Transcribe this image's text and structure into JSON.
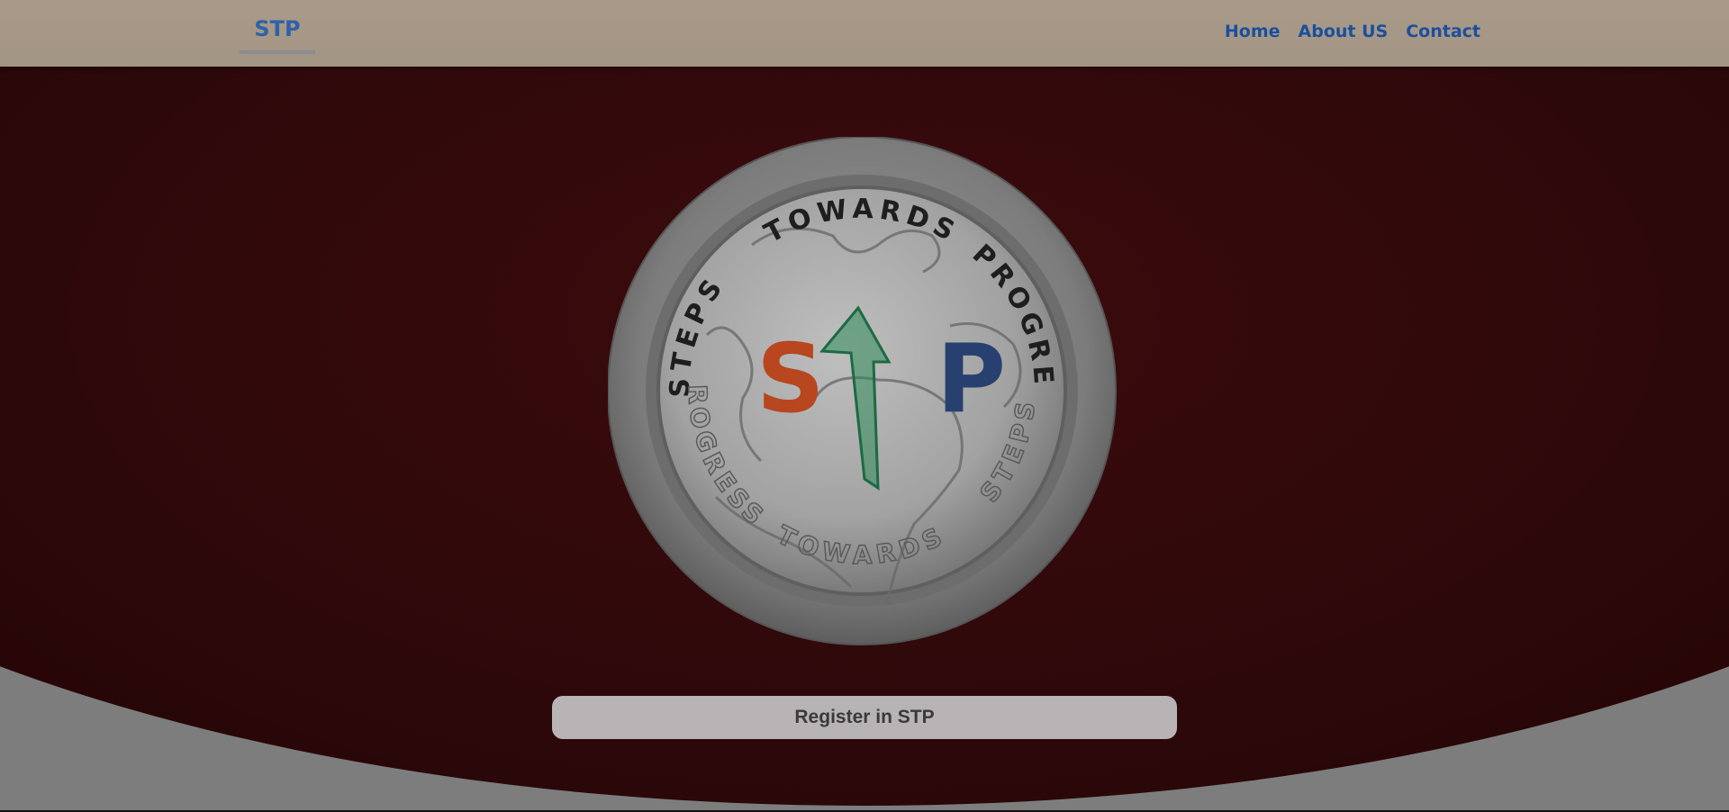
{
  "navbar": {
    "brand": "STP",
    "links": [
      {
        "label": "Home"
      },
      {
        "label": "About US"
      },
      {
        "label": "Contact"
      }
    ]
  },
  "logo": {
    "ring_text_top": "TOWARDS",
    "ring_text_left": "STEPS",
    "ring_text_right": "PROGRESS",
    "ring_text_bottom": "TOWARDS",
    "ring_text_lower_left": "PROGRESS",
    "ring_text_lower_right": "STEPS",
    "letter_s": "S",
    "letter_p": "P",
    "colors": {
      "s": "#b8461e",
      "p": "#27406f",
      "arrow": "#1d7a4c"
    }
  },
  "hero": {
    "register_label": "Register in STP"
  },
  "colors": {
    "navbar": "#a89886",
    "hero": "#2b0709",
    "background": "#7d7d7d",
    "link": "#1b4f9e",
    "button": "#b8b4b6"
  }
}
